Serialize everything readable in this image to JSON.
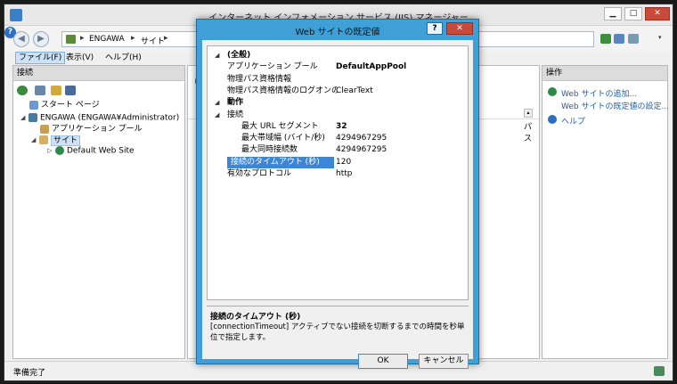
{
  "window": {
    "title": "インターネット インフォメーション サービス (IIS) マネージャー",
    "min": "▁",
    "max": "□",
    "close": "✕"
  },
  "address": {
    "crumbs": [
      "ENGAWA",
      "サイト"
    ],
    "sep": "▸",
    "help": "?",
    "help_dd": "▾"
  },
  "menu": {
    "file": "ファイル(F)",
    "view": "表示(V)",
    "help": "ヘルプ(H)"
  },
  "left": {
    "header": "接続",
    "tree": {
      "start": "スタート ページ",
      "server": "ENGAWA (ENGAWA¥Administrator)",
      "apppool": "アプリケーション プール",
      "sites": "サイト",
      "default_site": "Default Web Site"
    }
  },
  "center": {
    "col_path": "パス",
    "scroll": "▴"
  },
  "right": {
    "header": "操作",
    "actions": [
      "Web サイトの追加...",
      "Web サイトの既定値の設定...",
      "ヘルプ"
    ]
  },
  "status": {
    "text": "準備完了"
  },
  "dialog": {
    "title": "Web サイトの既定値",
    "help": "?",
    "close": "✕",
    "rows": [
      {
        "type": "category",
        "name": "(全般)"
      },
      {
        "name": "アプリケーション プール",
        "value": "DefaultAppPool",
        "bold": true
      },
      {
        "name": "物理パス資格情報",
        "value": ""
      },
      {
        "name": "物理パス資格情報のログオンの種類",
        "value": "ClearText"
      },
      {
        "type": "category",
        "name": "動作"
      },
      {
        "name": "接続",
        "value": "",
        "collapsible": true
      },
      {
        "name": "最大 URL セグメント",
        "value": "32",
        "bold": true,
        "indent": true
      },
      {
        "name": "最大帯域幅 (バイト/秒)",
        "value": "4294967295",
        "indent": true
      },
      {
        "name": "最大同時接続数",
        "value": "4294967295",
        "indent": true
      },
      {
        "name": "接続のタイムアウト (秒)",
        "value": "120",
        "indent": true,
        "selected": true
      },
      {
        "name": "有効なプロトコル",
        "value": "http"
      }
    ],
    "description": {
      "title": "接続のタイムアウト (秒)",
      "text": "[connectionTimeout] アクティブでない接続を切断するまでの時間を秒単位で指定します。"
    },
    "ok": "OK",
    "cancel": "キャンセル"
  }
}
